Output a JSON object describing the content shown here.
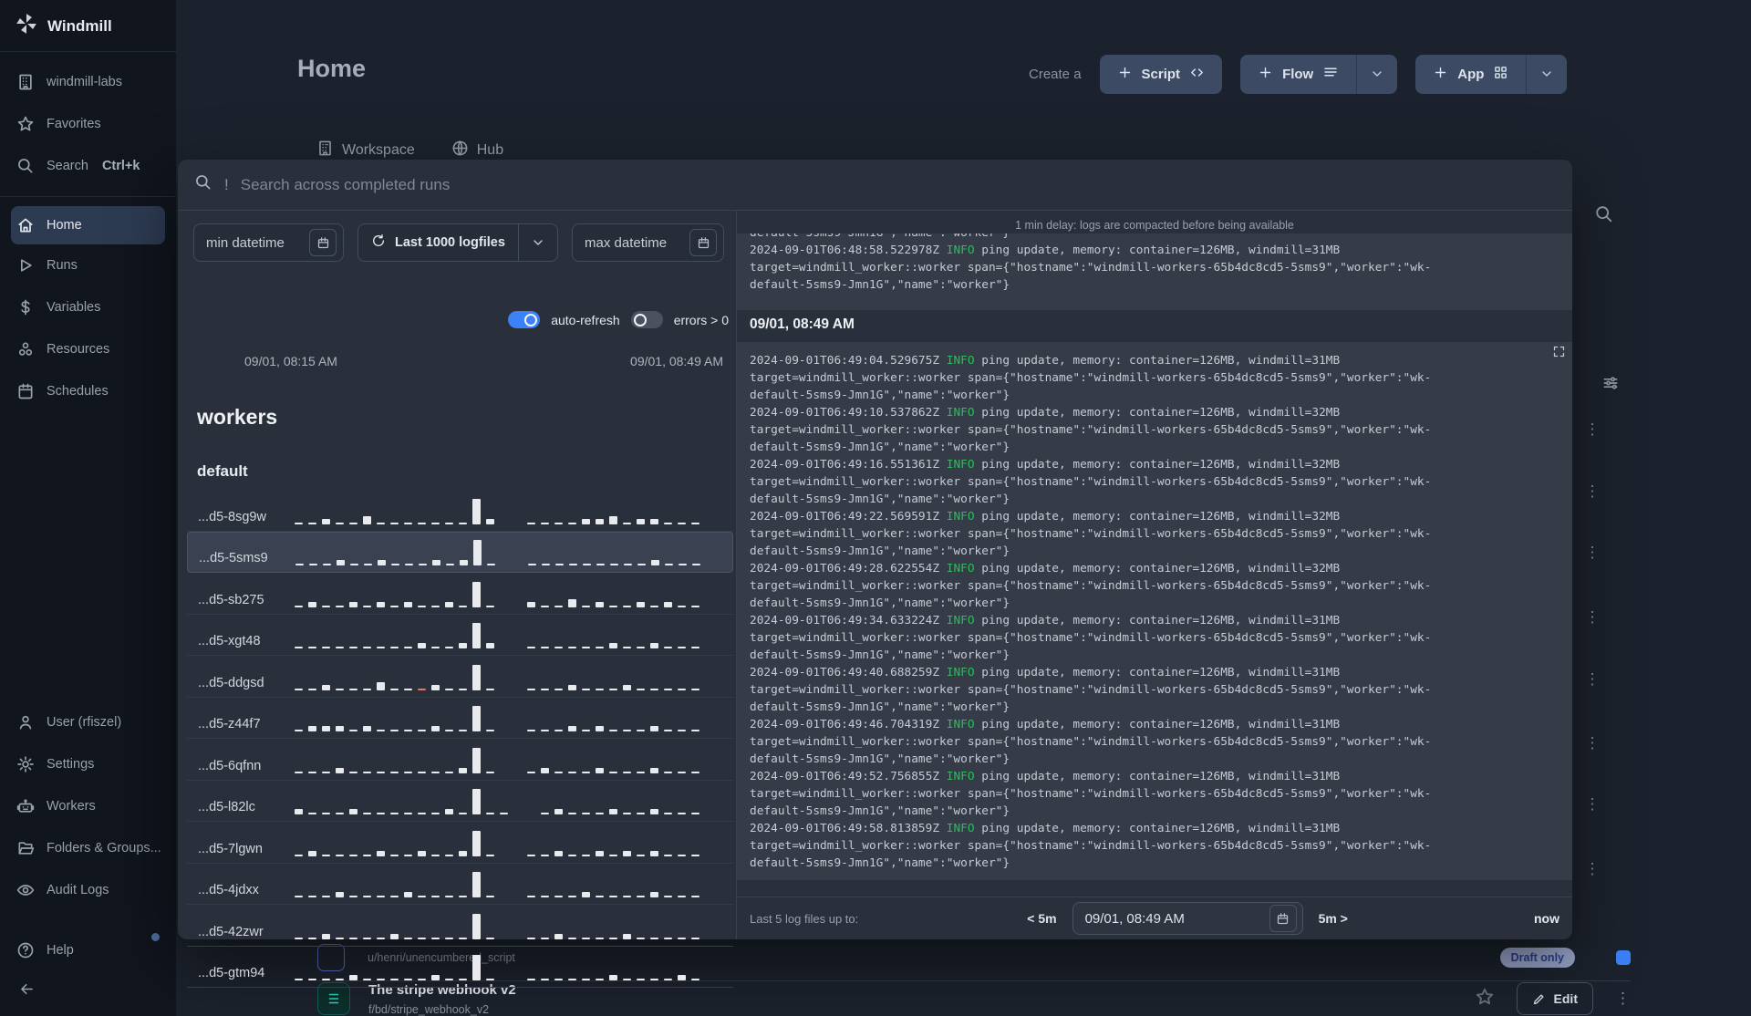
{
  "sidebar": {
    "brand": "Windmill",
    "top_items": [
      {
        "icon": "building-icon",
        "label": "windmill-labs"
      },
      {
        "icon": "star-icon",
        "label": "Favorites"
      },
      {
        "icon": "search-icon",
        "label": "Search",
        "shortcut": "Ctrl+k"
      }
    ],
    "nav_items": [
      {
        "icon": "home-icon",
        "label": "Home",
        "active": true
      },
      {
        "icon": "play-icon",
        "label": "Runs"
      },
      {
        "icon": "dollar-icon",
        "label": "Variables"
      },
      {
        "icon": "resources-icon",
        "label": "Resources"
      },
      {
        "icon": "calendar-icon",
        "label": "Schedules"
      }
    ],
    "bottom_items": [
      {
        "icon": "user-icon",
        "label": "User (rfiszel)"
      },
      {
        "icon": "gear-icon",
        "label": "Settings"
      },
      {
        "icon": "robot-icon",
        "label": "Workers"
      },
      {
        "icon": "folder-icon",
        "label": "Folders & Groups..."
      },
      {
        "icon": "eye-icon",
        "label": "Audit Logs"
      }
    ],
    "help_label": "Help"
  },
  "header": {
    "title": "Home",
    "create_label": "Create a",
    "script_label": "Script",
    "flow_label": "Flow",
    "app_label": "App"
  },
  "tabs": {
    "workspace": "Workspace",
    "hub": "Hub"
  },
  "background_rows": {
    "row_a_path": "u/henri/unencumbered_script",
    "row_a_badge": "Draft only",
    "row_b_title": "The stripe webhook v2",
    "row_b_path": "f/bd/stripe_webhook_v2",
    "row_b_edit": "Edit"
  },
  "modal": {
    "search_prefix": "!",
    "search_placeholder": "Search across completed runs",
    "filters": {
      "min_datetime": "min datetime",
      "logfiles": "Last 1000 logfiles",
      "max_datetime": "max datetime",
      "auto_refresh": "auto-refresh",
      "errors": "errors > 0"
    },
    "time_range": {
      "start": "09/01, 08:15 AM",
      "end": "09/01, 08:49 AM"
    },
    "workers_title": "workers",
    "group_title": "default",
    "workers": [
      {
        "name": "...d5-8sg9w",
        "bars": [
          1,
          1,
          2,
          1,
          1,
          3,
          1,
          1,
          1,
          1,
          1,
          1,
          1,
          4,
          2,
          0,
          0,
          1,
          1,
          1,
          1,
          2,
          2,
          3,
          1,
          2,
          2,
          1,
          1,
          1
        ]
      },
      {
        "name": "...d5-5sms9",
        "highlight": true,
        "bars": [
          1,
          1,
          1,
          2,
          1,
          1,
          2,
          1,
          1,
          1,
          2,
          1,
          2,
          4,
          1,
          0,
          0,
          1,
          1,
          1,
          1,
          1,
          1,
          1,
          1,
          1,
          2,
          1,
          1,
          1
        ]
      },
      {
        "name": "...d5-sb275",
        "bars": [
          1,
          2,
          1,
          1,
          2,
          1,
          2,
          1,
          2,
          1,
          1,
          2,
          1,
          4,
          1,
          0,
          0,
          2,
          1,
          1,
          3,
          1,
          2,
          1,
          1,
          2,
          1,
          2,
          1,
          1
        ]
      },
      {
        "name": "...d5-xgt48",
        "bars": [
          1,
          1,
          1,
          1,
          1,
          1,
          1,
          1,
          1,
          2,
          1,
          1,
          2,
          4,
          2,
          0,
          0,
          1,
          1,
          1,
          1,
          1,
          1,
          2,
          1,
          1,
          2,
          1,
          1,
          1
        ]
      },
      {
        "name": "...d5-ddgsd",
        "red_index": 9,
        "bars": [
          1,
          1,
          2,
          1,
          1,
          1,
          3,
          1,
          1,
          1,
          2,
          1,
          1,
          4,
          1,
          0,
          0,
          1,
          1,
          1,
          2,
          1,
          1,
          1,
          2,
          1,
          1,
          1,
          1,
          1
        ]
      },
      {
        "name": "...d5-z44f7",
        "bars": [
          1,
          2,
          2,
          2,
          1,
          2,
          1,
          1,
          1,
          1,
          2,
          1,
          1,
          4,
          1,
          0,
          0,
          1,
          1,
          1,
          2,
          1,
          2,
          1,
          1,
          1,
          2,
          1,
          1,
          1
        ]
      },
      {
        "name": "...d5-6qfnn",
        "bars": [
          1,
          1,
          1,
          2,
          1,
          1,
          1,
          1,
          1,
          1,
          1,
          1,
          2,
          4,
          1,
          0,
          0,
          1,
          2,
          1,
          1,
          1,
          2,
          1,
          1,
          1,
          2,
          1,
          1,
          1
        ]
      },
      {
        "name": "...d5-l82lc",
        "bars": [
          2,
          1,
          1,
          1,
          2,
          1,
          1,
          1,
          1,
          1,
          1,
          2,
          1,
          4,
          1,
          1,
          0,
          0,
          1,
          2,
          1,
          1,
          1,
          2,
          1,
          1,
          2,
          1,
          1,
          1
        ]
      },
      {
        "name": "...d5-7lgwn",
        "bars": [
          1,
          2,
          1,
          1,
          1,
          1,
          2,
          1,
          1,
          2,
          1,
          1,
          2,
          4,
          1,
          0,
          0,
          1,
          1,
          2,
          1,
          1,
          2,
          1,
          2,
          1,
          2,
          1,
          1,
          1
        ]
      },
      {
        "name": "...d5-4jdxx",
        "bars": [
          1,
          1,
          1,
          2,
          1,
          1,
          1,
          1,
          2,
          1,
          1,
          1,
          1,
          4,
          1,
          0,
          0,
          1,
          1,
          1,
          1,
          2,
          1,
          1,
          1,
          1,
          2,
          1,
          1,
          1
        ]
      },
      {
        "name": "...d5-42zwr",
        "bars": [
          1,
          1,
          2,
          1,
          1,
          1,
          1,
          2,
          1,
          1,
          1,
          1,
          1,
          4,
          1,
          0,
          0,
          1,
          1,
          2,
          1,
          1,
          1,
          1,
          2,
          1,
          1,
          1,
          1,
          1
        ]
      },
      {
        "name": "...d5-gtm94",
        "bars": [
          1,
          1,
          1,
          1,
          2,
          1,
          1,
          1,
          1,
          1,
          2,
          1,
          1,
          4,
          1,
          0,
          0,
          1,
          1,
          1,
          1,
          1,
          1,
          2,
          1,
          1,
          1,
          1,
          2,
          1
        ]
      }
    ],
    "log": {
      "delay_notice": "1 min delay: logs are compacted before being available",
      "section_header": "09/01, 08:49 AM",
      "info_label": "INFO",
      "msg_pre": " ping update, memory: container=126MB, windmill=",
      "line2": "target=windmill_worker::worker span={\"hostname\":\"windmill-workers-65b4dc8cd5-5sms9\",\"worker\":\"wk-",
      "line3": "default-5sms9-Jmn1G\",\"name\":\"worker\"}",
      "clipped_line": "default-5sms9-Jmn1G\",\"name\":\"worker\"}",
      "top_entries": [
        {
          "ts": "2024-09-01T06:48:58.522978Z",
          "mem": "31MB"
        }
      ],
      "entries": [
        {
          "ts": "2024-09-01T06:49:04.529675Z",
          "mem": "31MB"
        },
        {
          "ts": "2024-09-01T06:49:10.537862Z",
          "mem": "32MB"
        },
        {
          "ts": "2024-09-01T06:49:16.551361Z",
          "mem": "32MB"
        },
        {
          "ts": "2024-09-01T06:49:22.569591Z",
          "mem": "32MB"
        },
        {
          "ts": "2024-09-01T06:49:28.622554Z",
          "mem": "32MB"
        },
        {
          "ts": "2024-09-01T06:49:34.633224Z",
          "mem": "31MB"
        },
        {
          "ts": "2024-09-01T06:49:40.688259Z",
          "mem": "31MB"
        },
        {
          "ts": "2024-09-01T06:49:46.704319Z",
          "mem": "31MB"
        },
        {
          "ts": "2024-09-01T06:49:52.756855Z",
          "mem": "31MB"
        },
        {
          "ts": "2024-09-01T06:49:58.813859Z",
          "mem": "31MB"
        }
      ]
    },
    "footer": {
      "label": "Last 5 log files up to:",
      "back": "< 5m",
      "datetime": "09/01, 08:49 AM",
      "forward": "5m >",
      "now": "now"
    }
  }
}
